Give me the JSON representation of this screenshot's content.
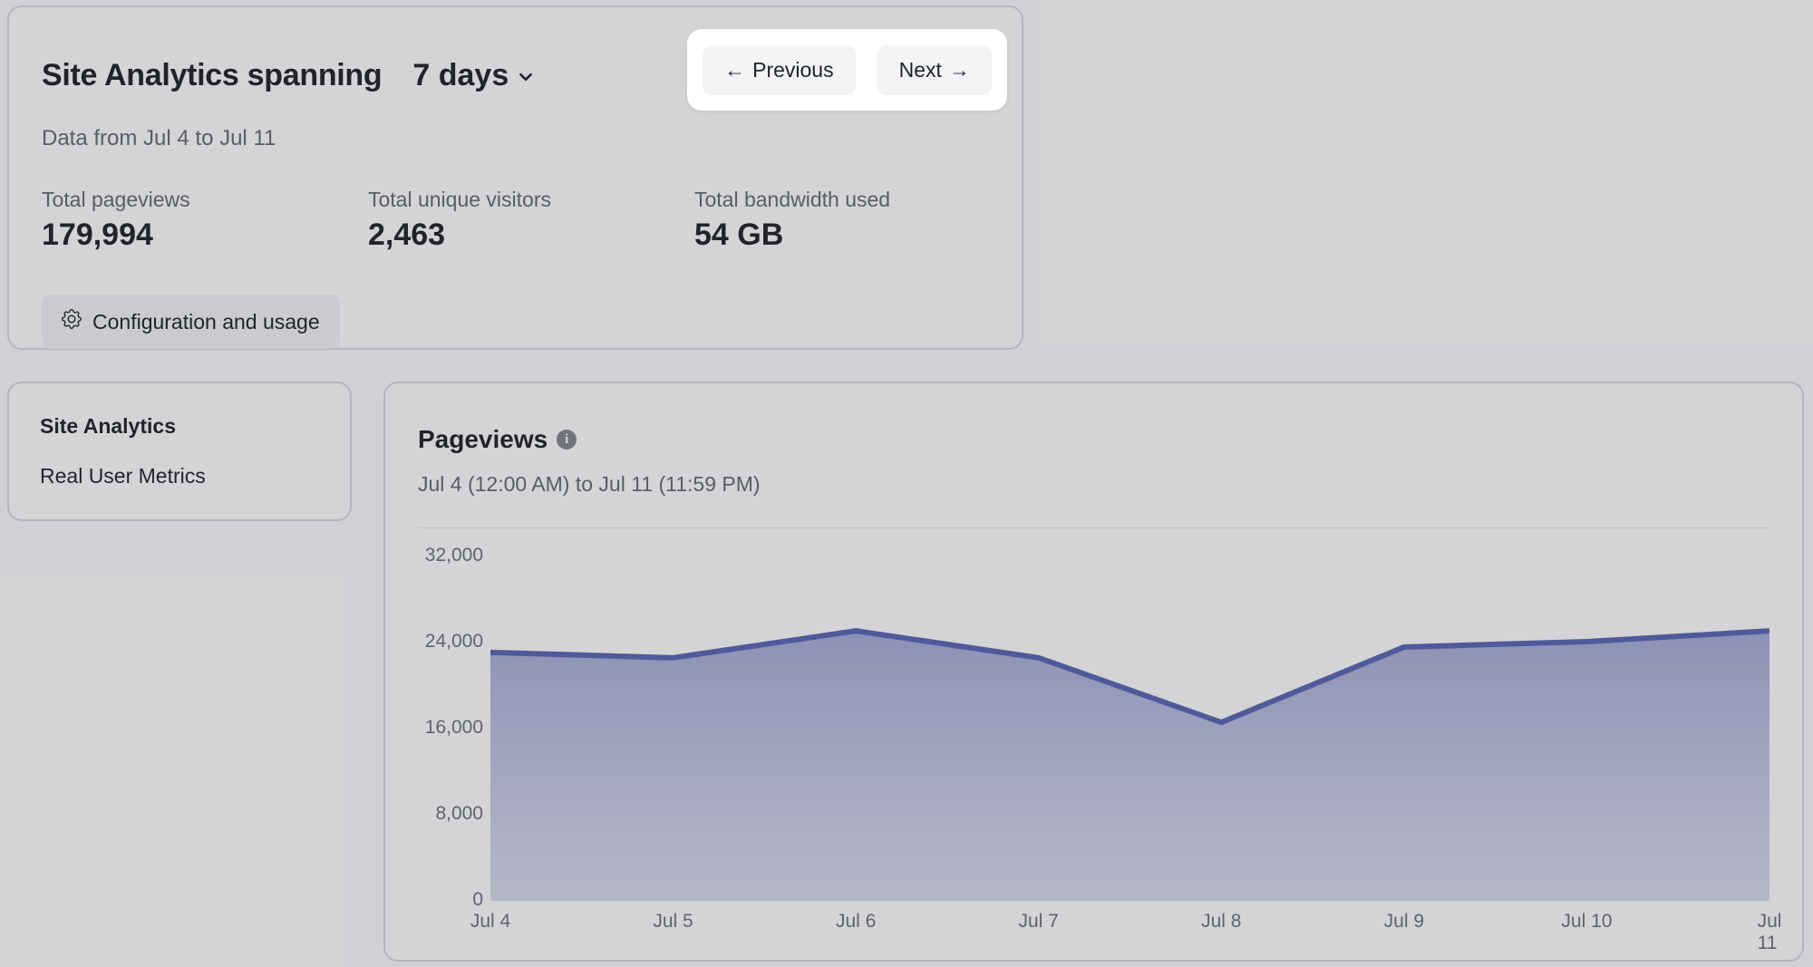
{
  "summary": {
    "title": "Site Analytics spanning",
    "range_selector_label": "7 days",
    "date_range": "Data from Jul 4 to Jul 11",
    "metrics": [
      {
        "label": "Total pageviews",
        "value": "179,994"
      },
      {
        "label": "Total unique visitors",
        "value": "2,463"
      },
      {
        "label": "Total bandwidth used",
        "value": "54 GB"
      }
    ],
    "config_button_label": "Configuration and usage"
  },
  "nav": {
    "previous": "Previous",
    "next": "Next"
  },
  "sidebar": {
    "items": [
      {
        "label": "Site Analytics",
        "active": true
      },
      {
        "label": "Real User Metrics",
        "active": false
      }
    ]
  },
  "chart": {
    "title": "Pageviews",
    "subtitle": "Jul 4 (12:00 AM) to Jul 11 (11:59 PM)",
    "y_ticks": [
      "32,000",
      "24,000",
      "16,000",
      "8,000",
      "0"
    ]
  },
  "chart_data": {
    "type": "area",
    "title": "Pageviews",
    "xlabel": "",
    "ylabel": "",
    "ylim": [
      0,
      32000
    ],
    "categories": [
      "Jul 4",
      "Jul 5",
      "Jul 6",
      "Jul 7",
      "Jul 8",
      "Jul 9",
      "Jul 10",
      "Jul 11"
    ],
    "values": [
      23000,
      22500,
      25000,
      22500,
      16500,
      23500,
      24000,
      25000
    ],
    "grid": false,
    "legend": false
  }
}
